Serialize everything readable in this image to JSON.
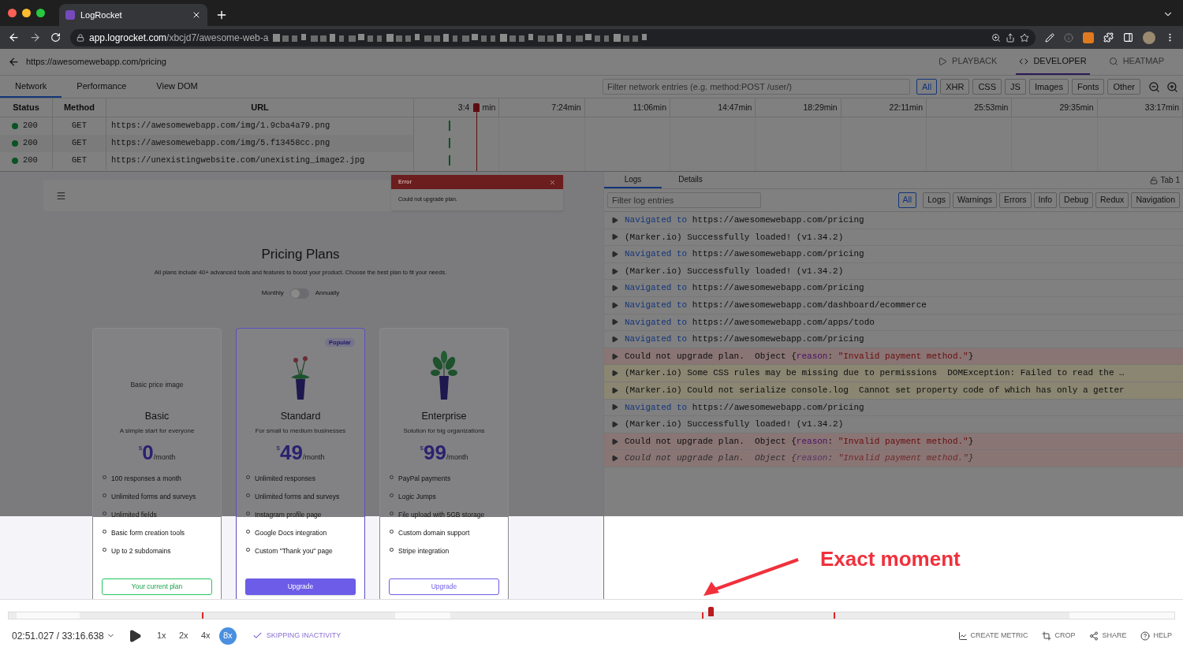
{
  "browser": {
    "tab_title": "LogRocket",
    "url_host": "app.logrocket.com",
    "url_path": "/xbcjd7/awesome-web-a"
  },
  "header": {
    "page_url": "https://awesomewebapp.com/pricing",
    "modes": [
      {
        "label": "PLAYBACK",
        "kind": "play",
        "selected": false
      },
      {
        "label": "DEVELOPER",
        "kind": "code",
        "selected": true
      },
      {
        "label": "HEATMAP",
        "kind": "search",
        "selected": false
      }
    ]
  },
  "dev_tabs": [
    {
      "label": "Network",
      "selected": true
    },
    {
      "label": "Performance",
      "selected": false
    },
    {
      "label": "View DOM",
      "selected": false
    }
  ],
  "network_filter": {
    "placeholder": "Filter network entries (e.g. method:POST /user/)",
    "types": [
      {
        "label": "All",
        "selected": true
      },
      {
        "label": "XHR",
        "selected": false
      },
      {
        "label": "CSS",
        "selected": false
      },
      {
        "label": "JS",
        "selected": false
      },
      {
        "label": "Images",
        "selected": false
      },
      {
        "label": "Fonts",
        "selected": false
      },
      {
        "label": "Other",
        "selected": false
      }
    ]
  },
  "network": {
    "columns": [
      "Status",
      "Method",
      "URL"
    ],
    "first_tick": {
      "before": "3:4",
      "after": "min"
    },
    "ticks": [
      "7:24min",
      "11:06min",
      "14:47min",
      "18:29min",
      "22:11min",
      "25:53min",
      "29:35min",
      "33:17min"
    ],
    "rows": [
      {
        "status": "200",
        "method": "GET",
        "url": "https://awesomewebapp.com/img/1.9cba4a79.png"
      },
      {
        "status": "200",
        "method": "GET",
        "url": "https://awesomewebapp.com/img/5.f13458cc.png"
      },
      {
        "status": "200",
        "method": "GET",
        "url": "https://unexistingwebsite.com/unexisting_image2.jpg"
      }
    ]
  },
  "replay": {
    "toast": {
      "title": "Error",
      "message": "Could not upgrade plan."
    },
    "title": "Pricing Plans",
    "subtitle": "All plans include 40+ advanced tools and features to boost your product. Choose the best plan to fit your needs.",
    "billing": {
      "left": "Monthly",
      "right": "Annually",
      "on": false
    },
    "plans": [
      {
        "name": "Basic",
        "kind": "broken",
        "image_alt": "Basic price image",
        "description": "A simple start for everyone",
        "currency": "$",
        "amount": "0",
        "period": "/month",
        "selected": false,
        "features": [
          "100 responses a month",
          "Unlimited forms and surveys",
          "Unlimited fields",
          "Basic form creation tools",
          "Up to 2 subdomains"
        ],
        "button": {
          "label": "Your current plan",
          "kind": "current"
        }
      },
      {
        "name": "Standard",
        "badge": "Popular",
        "kind": "flower",
        "description": "For small to medium businesses",
        "currency": "$",
        "amount": "49",
        "period": "/month",
        "selected": true,
        "features": [
          "Unlimited responses",
          "Unlimited forms and surveys",
          "Instagram profile page",
          "Google Docs integration",
          "Custom \"Thank you\" page"
        ],
        "button": {
          "label": "Upgrade",
          "kind": "primary"
        }
      },
      {
        "name": "Enterprise",
        "kind": "leaves",
        "description": "Solution for big organizations",
        "currency": "$",
        "amount": "99",
        "period": "/month",
        "selected": false,
        "features": [
          "PayPal payments",
          "Logic Jumps",
          "File upload with 5GB storage",
          "Custom domain support",
          "Stripe integration"
        ],
        "button": {
          "label": "Upgrade",
          "kind": "outline"
        }
      }
    ]
  },
  "logs": {
    "tabs": [
      {
        "label": "Logs",
        "selected": true
      },
      {
        "label": "Details",
        "selected": false
      }
    ],
    "tab_indicator": "Tab 1",
    "filter_placeholder": "Filter log entries",
    "levels": [
      {
        "label": "All",
        "selected": true
      },
      {
        "label": "Logs",
        "selected": false
      },
      {
        "label": "Warnings",
        "selected": false
      },
      {
        "label": "Errors",
        "selected": false
      },
      {
        "label": "Info",
        "selected": false
      },
      {
        "label": "Debug",
        "selected": false
      },
      {
        "label": "Redux",
        "selected": false
      },
      {
        "label": "Navigation",
        "selected": false
      }
    ],
    "entries": [
      {
        "kind": "info",
        "italic": false,
        "parts": [
          {
            "text": "Navigated to",
            "kind": "keyword"
          },
          {
            "text": " https://awesomewebapp.com/pricing",
            "kind": "plain"
          }
        ]
      },
      {
        "kind": "info",
        "italic": false,
        "parts": [
          {
            "text": "(Marker.io) Successfully loaded! (v1.34.2)",
            "kind": "plain"
          }
        ]
      },
      {
        "kind": "info",
        "italic": false,
        "parts": [
          {
            "text": "Navigated to",
            "kind": "keyword"
          },
          {
            "text": " https://awesomewebapp.com/pricing",
            "kind": "plain"
          }
        ]
      },
      {
        "kind": "info",
        "italic": false,
        "parts": [
          {
            "text": "(Marker.io) Successfully loaded! (v1.34.2)",
            "kind": "plain"
          }
        ]
      },
      {
        "kind": "info",
        "italic": false,
        "parts": [
          {
            "text": "Navigated to",
            "kind": "keyword"
          },
          {
            "text": " https://awesomewebapp.com/pricing",
            "kind": "plain"
          }
        ]
      },
      {
        "kind": "info",
        "italic": false,
        "parts": [
          {
            "text": "Navigated to",
            "kind": "keyword"
          },
          {
            "text": " https://awesomewebapp.com/dashboard/ecommerce",
            "kind": "plain"
          }
        ]
      },
      {
        "kind": "info",
        "italic": false,
        "parts": [
          {
            "text": "Navigated to",
            "kind": "keyword"
          },
          {
            "text": " https://awesomewebapp.com/apps/todo",
            "kind": "plain"
          }
        ]
      },
      {
        "kind": "info",
        "italic": false,
        "parts": [
          {
            "text": "Navigated to",
            "kind": "keyword"
          },
          {
            "text": " https://awesomewebapp.com/pricing",
            "kind": "plain"
          }
        ]
      },
      {
        "kind": "error",
        "italic": false,
        "parts": [
          {
            "text": "Could not upgrade plan.  Object {",
            "kind": "plain"
          },
          {
            "text": "reason",
            "kind": "key"
          },
          {
            "text": ": ",
            "kind": "plain"
          },
          {
            "text": "\"Invalid payment method.\"",
            "kind": "string"
          },
          {
            "text": "}",
            "kind": "plain"
          }
        ]
      },
      {
        "kind": "warning",
        "italic": false,
        "parts": [
          {
            "text": "(Marker.io) Some CSS rules may be missing due to permissions  DOMException: Failed to read the …",
            "kind": "plain"
          }
        ]
      },
      {
        "kind": "warning",
        "italic": false,
        "parts": [
          {
            "text": "(Marker.io) Could not serialize console.log  Cannot set property code of which has only a getter",
            "kind": "plain"
          }
        ]
      },
      {
        "kind": "info",
        "italic": false,
        "parts": [
          {
            "text": "Navigated to",
            "kind": "keyword"
          },
          {
            "text": " https://awesomewebapp.com/pricing",
            "kind": "plain"
          }
        ]
      },
      {
        "kind": "info",
        "italic": false,
        "parts": [
          {
            "text": "(Marker.io) Successfully loaded! (v1.34.2)",
            "kind": "plain"
          }
        ]
      },
      {
        "kind": "error",
        "italic": false,
        "parts": [
          {
            "text": "Could not upgrade plan.  Object {",
            "kind": "plain"
          },
          {
            "text": "reason",
            "kind": "key"
          },
          {
            "text": ": ",
            "kind": "plain"
          },
          {
            "text": "\"Invalid payment method.\"",
            "kind": "string"
          },
          {
            "text": "}",
            "kind": "plain"
          }
        ]
      },
      {
        "kind": "error",
        "italic": true,
        "parts": [
          {
            "text": "Could not upgrade plan.  Object {",
            "kind": "plain"
          },
          {
            "text": "reason",
            "kind": "key"
          },
          {
            "text": ": ",
            "kind": "plain"
          },
          {
            "text": "\"Invalid payment method.\"",
            "kind": "string"
          },
          {
            "text": "}",
            "kind": "plain"
          }
        ]
      }
    ]
  },
  "player": {
    "time": "02:51.027 / 33:16.638",
    "level": 0.6,
    "speeds": [
      {
        "label": "1x",
        "selected": false
      },
      {
        "label": "2x",
        "selected": false
      },
      {
        "label": "4x",
        "selected": false
      },
      {
        "label": "8x",
        "selected": true
      }
    ],
    "skipping": {
      "label": "SKIPPING INACTIVITY",
      "checked": true
    },
    "actions": [
      {
        "label": "CREATE METRIC",
        "kind": "chart"
      },
      {
        "label": "CROP",
        "kind": "crop"
      },
      {
        "label": "SHARE",
        "kind": "share"
      },
      {
        "label": "HELP",
        "kind": "help"
      }
    ]
  },
  "annotation": {
    "text": "Exact moment"
  }
}
